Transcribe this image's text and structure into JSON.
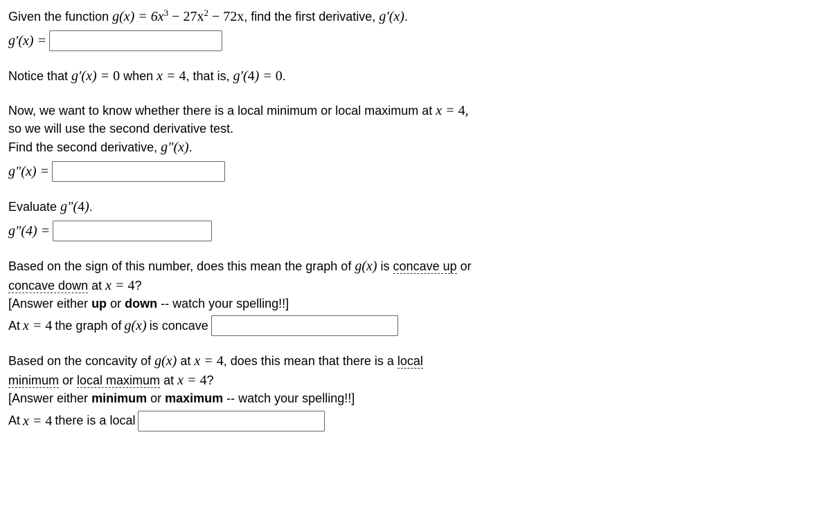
{
  "q1": {
    "prefix": "Given the function ",
    "func": "g(x) = 6x",
    "exp1": "3",
    "mid1": " − 27x",
    "exp2": "2",
    "mid2": " − 72x",
    "suffix": ", find the first derivative, ",
    "deriv": "g′(x)",
    "period": ".",
    "label": "g′(x) ="
  },
  "q2": {
    "line": "Notice that g′(x) = 0 when x = 4, that is, g′(4) = 0."
  },
  "q3": {
    "line1a": "Now, we want to know whether there is a local minimum or local maximum at ",
    "line1b": "x = 4,",
    "line2": "so we will use the second derivative test.",
    "line3a": "Find the second derivative, ",
    "line3b": "g\"(x)",
    "line3c": ".",
    "label": "g\"(x) ="
  },
  "q4": {
    "line1": "Evaluate g\"(4).",
    "label": "g\"(4) ="
  },
  "q5": {
    "l1a": "Based on the sign of this number, does this mean the graph of ",
    "l1b": "g(x)",
    "l1c": " is ",
    "l1d": "concave up",
    "l1e": " or",
    "l2a": "concave down",
    "l2b": " at ",
    "l2c": "x = 4",
    "l2d": "?",
    "l3a": "[Answer either ",
    "l3b": "up",
    "l3c": " or ",
    "l3d": "down",
    "l3e": " -- watch your spelling!!]",
    "l4a": "At ",
    "l4b": "x = 4",
    "l4c": " the graph of ",
    "l4d": "g(x)",
    "l4e": " is concave "
  },
  "q6": {
    "l1a": "Based on the concavity of ",
    "l1b": "g(x)",
    "l1c": " at ",
    "l1d": "x = 4",
    "l1e": ", does this mean that there is a ",
    "l1f": "local",
    "l2a": "minimum",
    "l2b": " or ",
    "l2c": "local maximum",
    "l2d": " at ",
    "l2e": "x = 4",
    "l2f": "?",
    "l3a": "[Answer either ",
    "l3b": "minimum",
    "l3c": " or ",
    "l3d": "maximum",
    "l3e": " -- watch your spelling!!]",
    "l4a": "At ",
    "l4b": "x = 4",
    "l4c": " there is a local "
  }
}
